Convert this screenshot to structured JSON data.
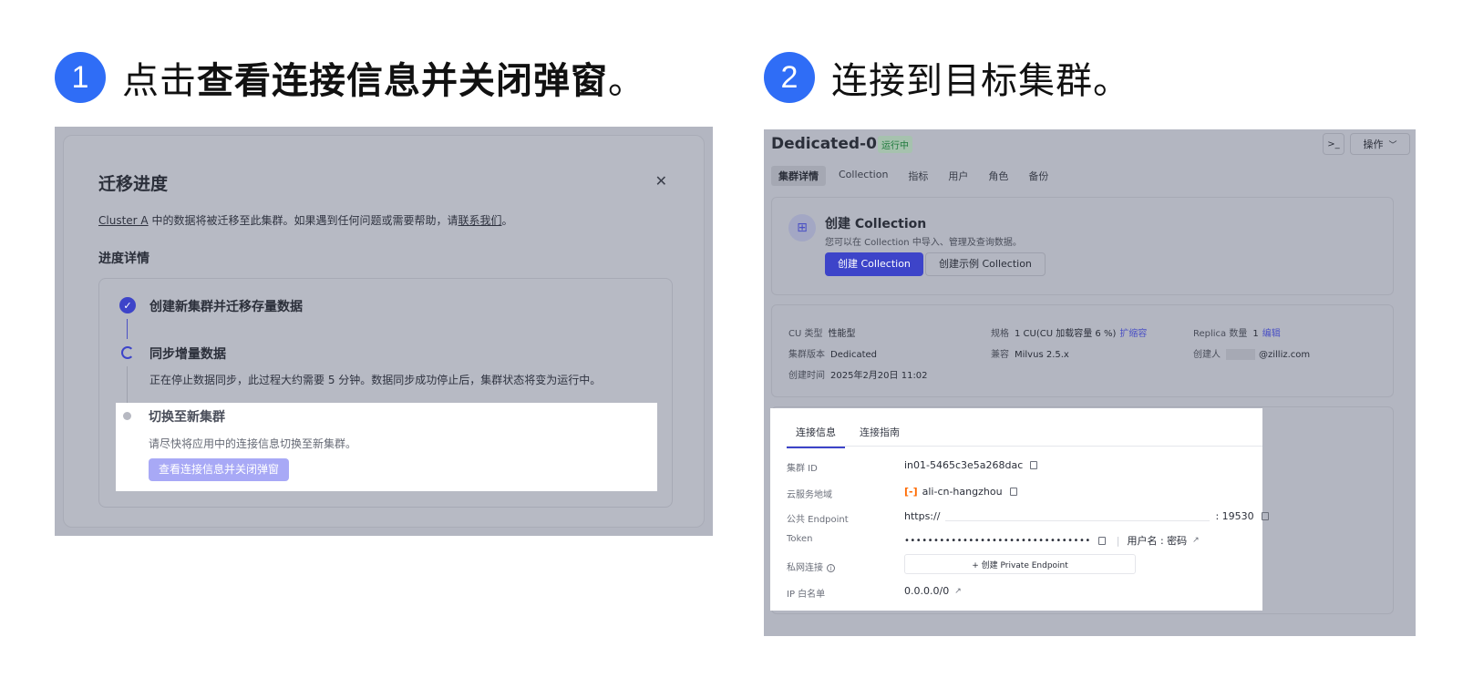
{
  "step1": {
    "num": "1",
    "prefix": "点击",
    "bold": "查看连接信息并关闭弹窗",
    "suffix": "。"
  },
  "step2": {
    "num": "2",
    "text": "连接到目标集群。"
  },
  "modal": {
    "title": "迁移进度",
    "close_icon": "close-icon",
    "desc": {
      "cluster": "Cluster A",
      "middle": " 中的数据将被迁移至此集群。如果遇到任何问题或需要帮助，请",
      "link": "联系我们",
      "end": "。"
    },
    "subtitle": "进度详情",
    "steps": [
      {
        "label": "创建新集群并迁移存量数据",
        "status": "done"
      },
      {
        "label": "同步增量数据",
        "status": "running",
        "desc": "正在停止数据同步，此过程大约需要 5 分钟。数据同步成功停止后，集群状态将变为运行中。"
      },
      {
        "label": "切换至新集群",
        "status": "pending",
        "desc": "请尽快将应用中的连接信息切换至新集群。",
        "button": "查看连接信息并关闭弹窗"
      }
    ]
  },
  "cluster": {
    "name": "Dedicated-02",
    "status": "运行中",
    "terminal_label": ">_",
    "ops_label": "操作",
    "tabs": [
      "集群详情",
      "Collection",
      "指标",
      "用户",
      "角色",
      "备份"
    ],
    "active_tab": "集群详情",
    "create_card": {
      "title": "创建 Collection",
      "desc": "您可以在 Collection 中导入、管理及查询数据。",
      "primary": "创建 Collection",
      "secondary": "创建示例 Collection"
    },
    "info": {
      "cu_type_k": "CU 类型",
      "cu_type_v": "性能型",
      "spec_k": "规格",
      "spec_v": "1 CU(CU 加载容量 6 %)",
      "spec_link": "扩缩容",
      "replica_k": "Replica 数量",
      "replica_v": "1",
      "replica_link": "编辑",
      "version_k": "集群版本",
      "version_v": "Dedicated",
      "compat_k": "兼容",
      "compat_v": "Milvus 2.5.x",
      "creator_k": "创建人",
      "creator_v": "@zilliz.com",
      "created_k": "创建时间",
      "created_v": "2025年2月20日 11:02"
    },
    "conn": {
      "tabs": [
        "连接信息",
        "连接指南"
      ],
      "active_tab": "连接信息",
      "rows": {
        "id_k": "集群 ID",
        "id_v": "in01-5465c3e5a268dac",
        "region_k": "云服务地域",
        "region_v": "ali-cn-hangzhou",
        "endpoint_k": "公共 Endpoint",
        "endpoint_prefix": "https://",
        "endpoint_port": ": 19530",
        "token_k": "Token",
        "token_v": "••••••••••••••••••••••••••••••••",
        "token_user": "用户名 : 密码",
        "private_k": "私网连接",
        "private_btn": "+ 创建 Private Endpoint",
        "ip_k": "IP 白名单",
        "ip_v": "0.0.0.0/0"
      }
    }
  }
}
